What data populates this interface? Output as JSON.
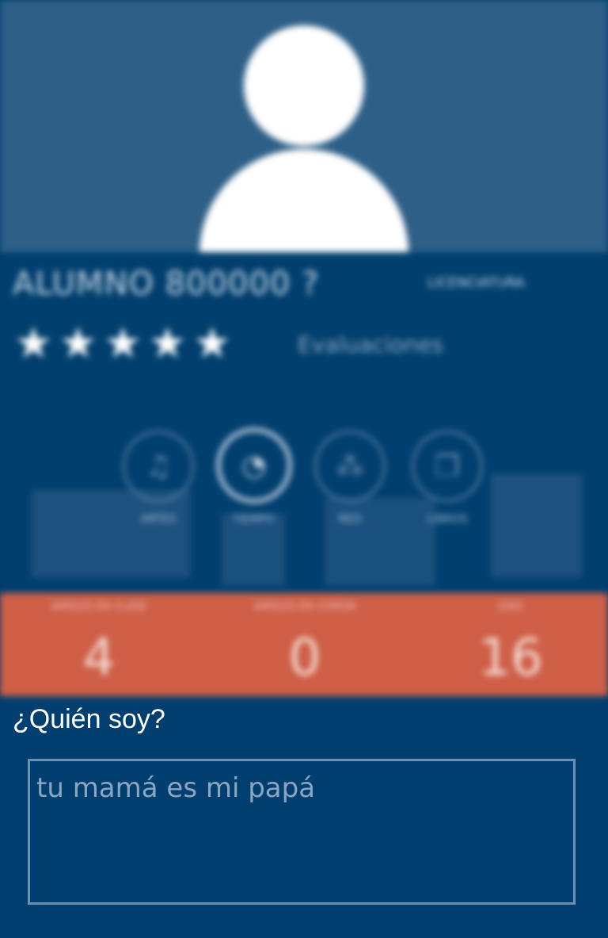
{
  "profile": {
    "name": "ALUMNO 800000 ?",
    "subject": "LICENCIATURA",
    "rating": 5,
    "stars": [
      "★",
      "★",
      "★",
      "★",
      "★"
    ],
    "evaluations_text": "Evaluaciones",
    "avatar_icon": "user-silhouette-icon"
  },
  "categories": [
    {
      "icon": "music-icon",
      "glyph": "♫",
      "label": "ARTES",
      "active": false
    },
    {
      "icon": "clock-icon",
      "glyph": "◔",
      "label": "TIEMPO",
      "active": true
    },
    {
      "icon": "network-icon",
      "glyph": "⁂",
      "label": "RED",
      "active": false
    },
    {
      "icon": "book-icon",
      "glyph": "❐",
      "label": "LIBROS",
      "active": false
    }
  ],
  "stats": [
    {
      "label": "AMIGOS EN CLASE",
      "value": "4"
    },
    {
      "label": "AMIGOS EN COMÚN",
      "value": "0"
    },
    {
      "label": "DÍAS",
      "value": "16"
    }
  ],
  "bio": {
    "label": "¿Quién soy?",
    "value": "tu mamá es mi papá"
  },
  "colors": {
    "header_bg": "#2d5f87",
    "page_bg": "#003f6f",
    "stats_bg": "#cf5f47",
    "text_white": "#ffffff"
  }
}
